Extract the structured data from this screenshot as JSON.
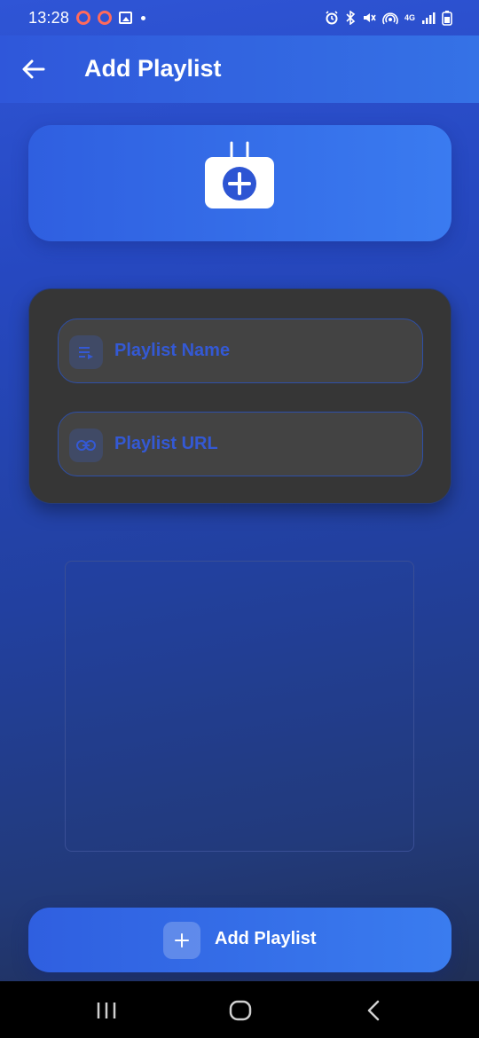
{
  "status_bar": {
    "time": "13:28",
    "left_icons": [
      "ring-icon",
      "ring-icon",
      "image-icon",
      "dot-icon"
    ],
    "right_icons": [
      "alarm-icon",
      "bluetooth-icon",
      "mute-icon",
      "hotspot-icon",
      "4g-icon",
      "signal-icon",
      "battery-icon"
    ],
    "network_label": "4G"
  },
  "app_bar": {
    "title": "Add Playlist",
    "back_icon": "arrow-left-icon"
  },
  "header_card": {
    "icon": "calendar-add-icon"
  },
  "form": {
    "name_field": {
      "placeholder": "Playlist Name",
      "value": "",
      "icon": "playlist-icon"
    },
    "url_field": {
      "placeholder": "Playlist URL",
      "value": "",
      "icon": "link-icon"
    }
  },
  "action": {
    "label": "Add Playlist",
    "icon": "plus-icon"
  },
  "nav_bar": {
    "items": [
      "recents-icon",
      "home-icon",
      "back-icon"
    ]
  },
  "colors": {
    "accent": "#3459d4",
    "app_bar": "#2f57da",
    "card": "#363636",
    "field": "#434343",
    "warning_ring": "#ff6a5c"
  }
}
